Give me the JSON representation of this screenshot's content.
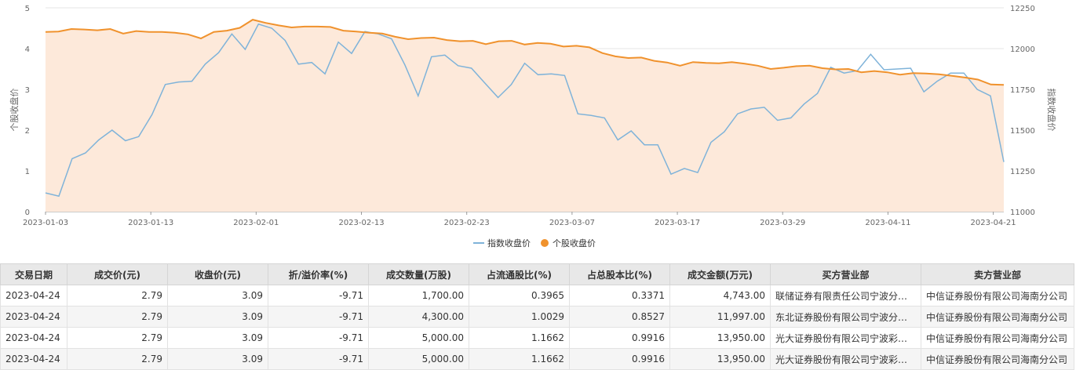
{
  "chart_data": {
    "type": "line",
    "y_left": {
      "label": "个股收盘价",
      "range": [
        0,
        5
      ],
      "ticks": [
        "0",
        "1",
        "2",
        "3",
        "4",
        "5"
      ]
    },
    "y_right": {
      "label": "指数收盘价",
      "range": [
        11000,
        12250
      ],
      "ticks": [
        "11000",
        "11250",
        "11500",
        "11750",
        "12000",
        "12250"
      ]
    },
    "x_ticks": [
      "2023-01-03",
      "2023-01-13",
      "2023-02-01",
      "2023-02-13",
      "2023-02-23",
      "2023-03-07",
      "2023-03-17",
      "2023-03-29",
      "2023-04-11",
      "2023-04-21"
    ],
    "x_tick_index": [
      0,
      10,
      20,
      30,
      40,
      50,
      60,
      70,
      80,
      90
    ],
    "n_points": 92,
    "series": [
      {
        "name": "指数收盘价",
        "axis": "right",
        "color": "#7fb3d9",
        "values": [
          11115,
          11095,
          11325,
          11360,
          11440,
          11500,
          11435,
          11460,
          11595,
          11780,
          11795,
          11800,
          11905,
          11975,
          12090,
          11995,
          12150,
          12125,
          12050,
          11905,
          11915,
          11845,
          12040,
          11970,
          12105,
          12090,
          12060,
          11900,
          11710,
          11950,
          11960,
          11895,
          11880,
          11790,
          11700,
          11780,
          11910,
          11840,
          11845,
          11835,
          11600,
          11590,
          11575,
          11440,
          11495,
          11410,
          11410,
          11230,
          11265,
          11240,
          11425,
          11490,
          11600,
          11630,
          11640,
          11560,
          11575,
          11660,
          11725,
          11885,
          11850,
          11865,
          11965,
          11870,
          11875,
          11880,
          11735,
          11800,
          11850,
          11850,
          11750,
          11710,
          11305
        ]
      },
      {
        "name": "个股收盘价",
        "axis": "left",
        "color": "#f0922d",
        "fill": "#fde9da",
        "values": [
          4.41,
          4.42,
          4.48,
          4.47,
          4.45,
          4.48,
          4.37,
          4.43,
          4.41,
          4.41,
          4.39,
          4.35,
          4.25,
          4.41,
          4.44,
          4.51,
          4.71,
          4.63,
          4.57,
          4.52,
          4.54,
          4.54,
          4.53,
          4.44,
          4.42,
          4.39,
          4.37,
          4.29,
          4.23,
          4.26,
          4.27,
          4.21,
          4.18,
          4.19,
          4.11,
          4.18,
          4.19,
          4.1,
          4.14,
          4.12,
          4.05,
          4.07,
          4.03,
          3.89,
          3.81,
          3.77,
          3.78,
          3.7,
          3.66,
          3.58,
          3.67,
          3.65,
          3.64,
          3.67,
          3.63,
          3.58,
          3.5,
          3.53,
          3.57,
          3.58,
          3.52,
          3.49,
          3.5,
          3.42,
          3.45,
          3.42,
          3.36,
          3.4,
          3.39,
          3.37,
          3.33,
          3.29,
          3.24,
          3.12,
          3.11
        ]
      }
    ]
  },
  "legend": [
    {
      "label": "指数收盘价",
      "color": "#7fb3d9"
    },
    {
      "label": "个股收盘价",
      "color": "#f0922d"
    }
  ],
  "table": {
    "headers": [
      "交易日期",
      "成交价(元)",
      "收盘价(元)",
      "折/溢价率(%)",
      "成交数量(万股)",
      "占流通股比(%)",
      "占总股本比(%)",
      "成交金额(万元)",
      "买方营业部",
      "卖方营业部"
    ],
    "rows": [
      [
        "2023-04-24",
        "2.79",
        "3.09",
        "-9.71",
        "1,700.00",
        "0.3965",
        "0.3371",
        "4,743.00",
        "联储证券有限责任公司宁波分公司",
        "中信证券股份有限公司海南分公司"
      ],
      [
        "2023-04-24",
        "2.79",
        "3.09",
        "-9.71",
        "4,300.00",
        "1.0029",
        "0.8527",
        "11,997.00",
        "东北证券股份有限公司宁波分公司",
        "中信证券股份有限公司海南分公司"
      ],
      [
        "2023-04-24",
        "2.79",
        "3.09",
        "-9.71",
        "5,000.00",
        "1.1662",
        "0.9916",
        "13,950.00",
        "光大证券股份有限公司宁波彩虹...",
        "中信证券股份有限公司海南分公司"
      ],
      [
        "2023-04-24",
        "2.79",
        "3.09",
        "-9.71",
        "5,000.00",
        "1.1662",
        "0.9916",
        "13,950.00",
        "光大证券股份有限公司宁波彩虹...",
        "中信证券股份有限公司海南分公司"
      ]
    ]
  }
}
